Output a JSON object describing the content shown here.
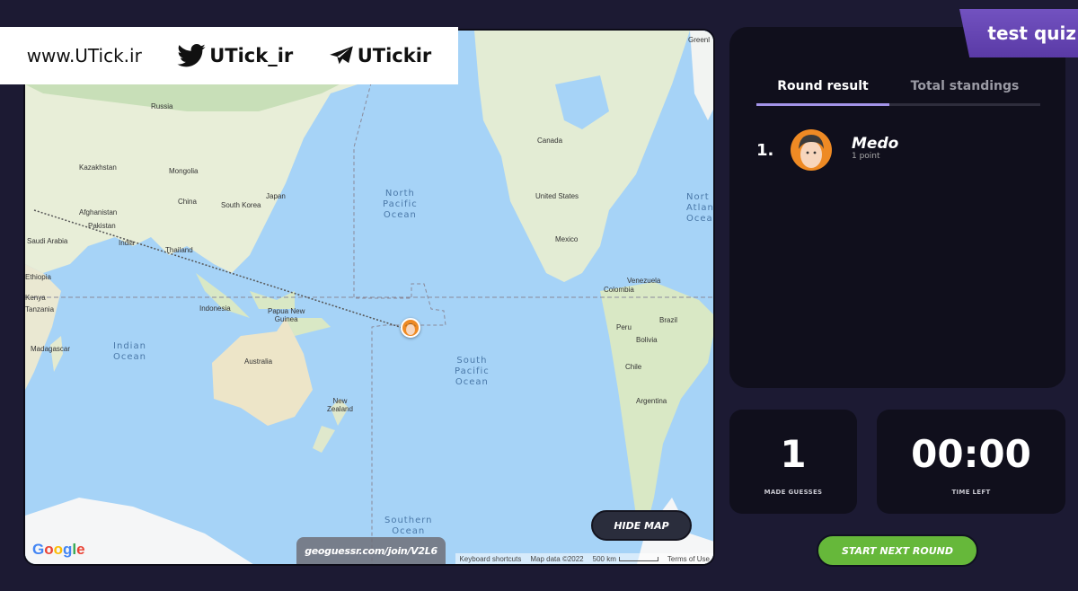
{
  "watermark": {
    "site": "www.UTick.ir",
    "twitter_icon": "twitter-bird-icon",
    "twitter": "UTick_ir",
    "telegram_icon": "telegram-plane-icon",
    "telegram": "UTickir"
  },
  "quiz": {
    "title": "test quiz"
  },
  "results": {
    "tabs": [
      {
        "label": "Round result",
        "active": true
      },
      {
        "label": "Total standings",
        "active": false
      }
    ],
    "rows": [
      {
        "rank": "1.",
        "name": "Medo",
        "points": "1 point",
        "avatar_icon": "player-avatar-icon"
      }
    ]
  },
  "stats": {
    "guesses_value": "1",
    "guesses_label": "MADE GUESSES",
    "time_value": "00:00",
    "time_label": "TIME LEFT"
  },
  "buttons": {
    "hide_map": "HIDE MAP",
    "start_next_round": "START NEXT ROUND"
  },
  "map": {
    "join_link": "geoguessr.com/join/V2L6",
    "google_logo": "Google",
    "attribution": {
      "shortcuts": "Keyboard shortcuts",
      "map_data": "Map data ©2022",
      "scale": "500 km",
      "terms": "Terms of Use"
    },
    "labels": {
      "russia": "Russia",
      "kazakhstan": "Kazakhstan",
      "mongolia": "Mongolia",
      "china": "China",
      "japan": "Japan",
      "south_korea": "South Korea",
      "afghanistan": "Afghanistan",
      "pakistan": "Pakistan",
      "saudi_arabia": "Saudi Arabia",
      "india": "India",
      "thailand": "Thailand",
      "ethiopia": "Ethiopia",
      "kenya": "Kenya",
      "tanzania": "Tanzania",
      "madagascar": "Madagascar",
      "indonesia": "Indonesia",
      "papua_new_guinea": "Papua New\nGuinea",
      "australia": "Australia",
      "new_zealand": "New\nZealand",
      "canada": "Canada",
      "united_states": "United States",
      "mexico": "Mexico",
      "venezuela": "Venezuela",
      "colombia": "Colombia",
      "peru": "Peru",
      "brazil": "Brazil",
      "bolivia": "Bolivia",
      "chile": "Chile",
      "argentina": "Argentina",
      "greenland": "Greenl",
      "north_pacific": "North\nPacific\nOcean",
      "south_pacific": "South\nPacific\nOcean",
      "indian_ocean": "Indian\nOcean",
      "southern_ocean": "Southern\nOcean",
      "north_atlantic": "Nort\nAtlan\nOcea"
    }
  }
}
